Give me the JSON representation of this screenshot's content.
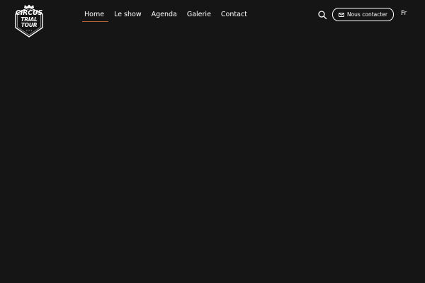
{
  "brand": {
    "logo_line1": "CIRCUS",
    "logo_line2": "TRIAL TOUR",
    "logo_line3": "· · ·",
    "logo_icon": "crown-icon"
  },
  "nav": {
    "items": [
      {
        "label": "Home",
        "active": true
      },
      {
        "label": "Le show",
        "active": false
      },
      {
        "label": "Agenda",
        "active": false
      },
      {
        "label": "Galerie",
        "active": false
      },
      {
        "label": "Contact",
        "active": false
      }
    ]
  },
  "header_actions": {
    "search_icon": "search-icon",
    "contact_label": "Nous contacter",
    "contact_icon": "mail-icon",
    "language": "Fr"
  },
  "colors": {
    "background": "#151515",
    "text": "#ffffff",
    "active_underline": "#b5653a"
  }
}
